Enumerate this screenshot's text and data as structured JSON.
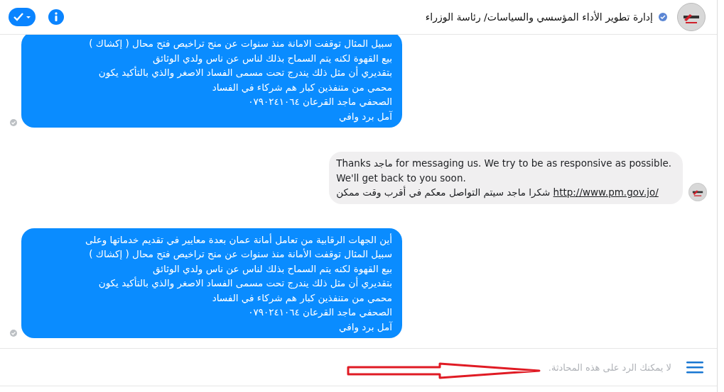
{
  "header": {
    "title": "إدارة تطوير الأداء المؤسسي والسياسات/ رئاسة الوزراء",
    "verified": true,
    "avatar": {
      "kind": "logo"
    }
  },
  "toolbar": [
    {
      "kind": "done"
    },
    {
      "kind": "info"
    }
  ],
  "messages": [
    {
      "kind": "outgoing",
      "seen": true,
      "lines": [
        "سبيل المثال توقفت الامانة منذ سنوات عن منح تراخيص فتح محال  ( إكشاك )",
        "بيع القهوة  لكنه يتم السماح بذلك لناس عن ناس ولدي الوثائق",
        "بتقديري أن مثل ذلك يندرج تحت مسمى الفساد الاصغر والذي بالتأكيد يكون",
        "محمي من متنفذين كبار هم شركاء في الفساد",
        "الصحفي ماجد القرعان ٠٧٩٠٢٤١٠٦٤",
        "آمل برد وافي"
      ]
    },
    {
      "kind": "incoming",
      "lines": [
        "Thanks ماجد for messaging us. We try to be as responsive as possible.",
        "We'll get back to you soon."
      ],
      "link": "http://www.pm.gov.jo/",
      "link_text": "شكرا ماجد سيتم التواصل معكم في أقرب وقت ممكن"
    },
    {
      "kind": "outgoing",
      "seen": true,
      "lines": [
        "أين الجهات الرقابية من تعامل أمانة عمان بعدة معايير في تقديم خدماتها وعلى",
        "سبيل المثال توقفت الأمانة منذ سنوات عن منح تراخيص فتح محال  ( إكشاك )",
        "بيع القهوة  لكنه يتم السماح بذلك لناس عن ناس ولدي الوثائق",
        "بتقديري أن مثل ذلك يندرج تحت مسمى الفساد الاصغر والذي بالتأكيد يكون",
        "محمي من متنفذين كبار هم شركاء في الفساد",
        "الصحفي ماجد القرعان ٠٧٩٠٢٤١٠٦٤",
        "آمل برد وافي"
      ]
    }
  ],
  "composer": {
    "notice": "لا يمكنك الرد على هذه المحادثة."
  },
  "annotation": {
    "kind": "arrow"
  }
}
